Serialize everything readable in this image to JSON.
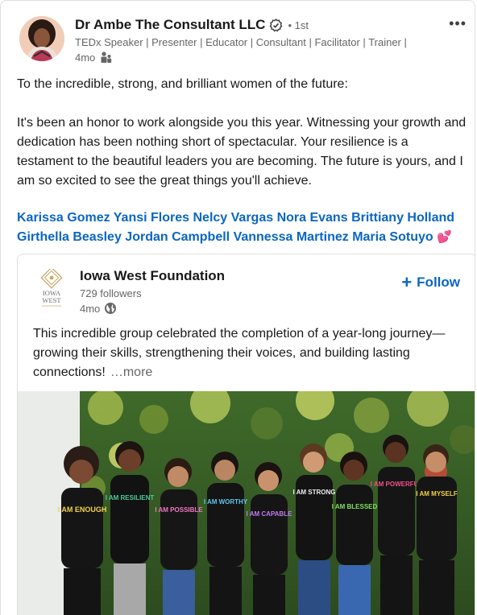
{
  "author": {
    "name": "Dr Ambe The Consultant LLC",
    "degree": "• 1st",
    "headline": "TEDx Speaker | Presenter | Educator | Consultant | Facilitator | Trainer |",
    "time": "4mo",
    "audience_icon": "connections-icon"
  },
  "post": {
    "paragraph1": "To the incredible, strong, and brilliant women of the future:",
    "paragraph2": "It's been an honor to work alongside you this year. Witnessing your growth and dedication has been nothing short of spectacular. Your resilience is a testament to the beautiful leaders you are becoming. The future is yours, and I am so excited to see the great things you'll achieve.",
    "mentions": [
      "Karissa Gomez",
      "Yansi Flores",
      "Nelcy Vargas",
      "Nora Evans",
      "Brittiany Holland",
      "Girthella Beasley",
      "Jordan Campbell",
      "Vannessa Martinez",
      "Maria Sotuyo"
    ],
    "emoji": "💕"
  },
  "menu_label": "•••",
  "reshare": {
    "org_name": "Iowa West Foundation",
    "logo_text_1": "IOWA",
    "logo_text_2": "WEST",
    "followers": "729 followers",
    "time": "4mo",
    "visibility_icon": "globe-icon",
    "follow_label": "Follow",
    "text": "This incredible group celebrated the completion of a year-long journey—growing their skills, strengthening their voices, and building lasting connections!",
    "see_more": "…more"
  },
  "photo": {
    "shirt_labels": [
      "I AM ENOUGH",
      "I AM RESILIENT",
      "I AM POSSIBLE",
      "I AM WORTHY",
      "I AM CAPABLE",
      "I AM STRONG",
      "I AM BLESSED",
      "I AM POWERFUL",
      "I AM MYSELF"
    ]
  },
  "colors": {
    "link": "#0a66c2",
    "muted": "#666666",
    "text": "#191919"
  }
}
